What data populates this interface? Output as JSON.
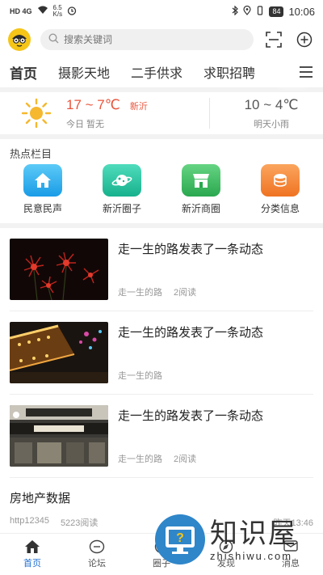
{
  "status_bar": {
    "network": "HD 4G",
    "speed": "6.5",
    "speed_unit": "K/s",
    "battery": "84",
    "time": "10:06"
  },
  "header": {
    "search_placeholder": "搜索关键词"
  },
  "tabs": [
    {
      "label": "首页",
      "active": true
    },
    {
      "label": "摄影天地"
    },
    {
      "label": "二手供求"
    },
    {
      "label": "求职招聘"
    }
  ],
  "weather": {
    "today_temp": "17 ~ 7℃",
    "city": "新沂",
    "today_label": "今日 暂无",
    "tomorrow_temp": "10 ~ 4℃",
    "tomorrow_label": "明天小雨"
  },
  "hot": {
    "title": "热点栏目",
    "items": [
      {
        "label": "民意民声",
        "color": "#2fb2f0",
        "icon": "home-icon"
      },
      {
        "label": "新沂圈子",
        "color": "#2cc9a4",
        "icon": "planet-icon"
      },
      {
        "label": "新沂商圈",
        "color": "#3ebe61",
        "icon": "shop-icon"
      },
      {
        "label": "分类信息",
        "color": "#f58a3e",
        "icon": "coins-icon"
      }
    ]
  },
  "feed": [
    {
      "title": "走一生的路发表了一条动态",
      "author": "走一生的路",
      "reads": "2阅读"
    },
    {
      "title": "走一生的路发表了一条动态",
      "author": "走一生的路",
      "reads": ""
    },
    {
      "title": "走一生的路发表了一条动态",
      "author": "走一生的路",
      "reads": "2阅读"
    }
  ],
  "text_item": {
    "title": "房地产数据",
    "source": "http12345",
    "reads": "5223阅读",
    "time": "昨天13:46"
  },
  "bottom_nav": [
    {
      "label": "首页",
      "active": true
    },
    {
      "label": "论坛"
    },
    {
      "label": "圈子"
    },
    {
      "label": "发现"
    },
    {
      "label": "消息"
    }
  ],
  "watermark": {
    "big": "知识屋",
    "small": "zhishiwu.com"
  },
  "colors": {
    "accent": "#1f6fd1",
    "temp": "#e9543b"
  }
}
